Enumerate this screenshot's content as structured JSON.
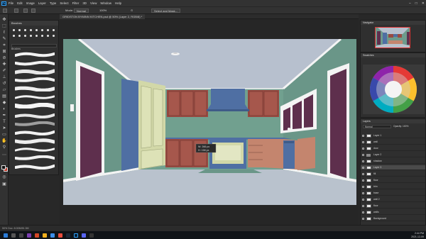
{
  "menubar": {
    "items": [
      "File",
      "Edit",
      "Image",
      "Layer",
      "Type",
      "Select",
      "Filter",
      "3D",
      "View",
      "Window",
      "Help"
    ],
    "window_controls": [
      "–",
      "□",
      "✕"
    ]
  },
  "options": {
    "mode_label": "Normal",
    "opacity": "100%",
    "flow": "100%",
    "mask_button": "Select and Mask..."
  },
  "document": {
    "tab_title": "GRIDSTON BYMINN KITCHEN.psd @ 50% (Layer 2, RGB/8) *",
    "zoom": "50%",
    "transform_readout": [
      "W: 266 px",
      "H: 158 px"
    ]
  },
  "brushes_panel": {
    "title": "Brushes",
    "folder_name": "Brushes"
  },
  "right_panels": {
    "navigator_title": "Navigator",
    "swatches_title": "Swatches",
    "layers_title": "Layers",
    "blend_mode": "Normal",
    "opacity_label": "Opacity: 100%",
    "layers": [
      {
        "name": "Layer 1",
        "type": "layer"
      },
      {
        "name": "wall",
        "type": "layer"
      },
      {
        "name": "door",
        "type": "layer"
      },
      {
        "name": "Layer 2",
        "type": "group"
      },
      {
        "name": "shadow",
        "type": "layer"
      },
      {
        "name": "Layer 3",
        "type": "layer",
        "selected": true
      },
      {
        "name": "fill",
        "type": "layer"
      },
      {
        "name": "floor",
        "type": "layer"
      },
      {
        "name": "trim",
        "type": "layer"
      },
      {
        "name": "base",
        "type": "layer"
      },
      {
        "name": "wall 2",
        "type": "layer"
      },
      {
        "name": "floor",
        "type": "layer"
      },
      {
        "name": "walls",
        "type": "layer"
      },
      {
        "name": "Background",
        "type": "layer"
      }
    ]
  },
  "statusbar": {
    "text": "50%   Doc: 8.00M/81.3M"
  },
  "taskbar": {
    "time": "2:44 PM",
    "date": "2021-12-09"
  },
  "colors": {
    "wall_green": "#6d9a8c",
    "ceiling": "#b7c0ce",
    "floor": "#b9c2cd",
    "upper_cabinets": "#9a4a42",
    "base_cabinets": "#c4856e",
    "fridge_blue": "#4f6fa3",
    "pantry_cream": "#d2d8a8",
    "door_plum": "#5e2f4d",
    "trim_white": "#f4f4f4"
  }
}
